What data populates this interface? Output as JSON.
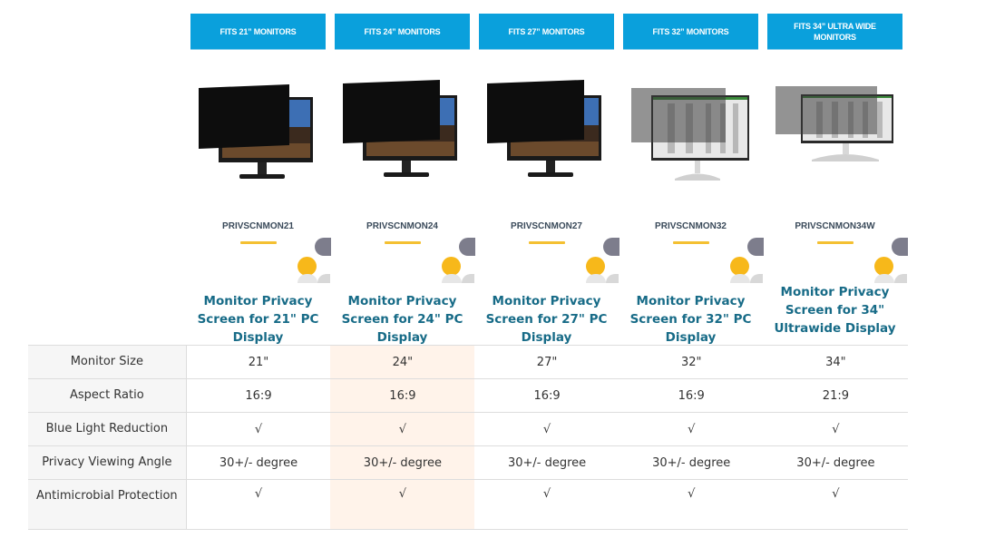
{
  "products": [
    {
      "fit_label": "FITS 21” MONITORS",
      "sku": "PRIVSCNMON21",
      "title": "Monitor Privacy Screen for 21\" PC Display",
      "image": "dark-privacy-monitor-icon",
      "highlighted": false
    },
    {
      "fit_label": "FITS 24” MONITORS",
      "sku": "PRIVSCNMON24",
      "title": "Monitor Privacy Screen for 24\" PC Display",
      "image": "dark-privacy-monitor-icon",
      "highlighted": true
    },
    {
      "fit_label": "FITS 27” MONITORS",
      "sku": "PRIVSCNMON27",
      "title": "Monitor Privacy Screen for 27\" PC Display",
      "image": "dark-privacy-monitor-icon",
      "highlighted": false
    },
    {
      "fit_label": "FITS 32” MONITORS",
      "sku": "PRIVSCNMON32",
      "title": "Monitor Privacy Screen for 32\" PC Display",
      "image": "gray-privacy-monitor-icon",
      "highlighted": false
    },
    {
      "fit_label": "FITS 34” ULTRA WIDE MONITORS",
      "sku": "PRIVSCNMON34W",
      "title": "Monitor Privacy Screen for 34\" Ultrawide Display",
      "image": "ultrawide-privacy-monitor-icon",
      "highlighted": false
    }
  ],
  "rows": [
    {
      "label": "Monitor Size",
      "values": [
        "21\"",
        "24\"",
        "27\"",
        "32\"",
        "34\""
      ]
    },
    {
      "label": "Aspect Ratio",
      "values": [
        "16:9",
        "16:9",
        "16:9",
        "16:9",
        "21:9"
      ]
    },
    {
      "label": "Blue Light Reduction",
      "values": [
        "√",
        "√",
        "√",
        "√",
        "√"
      ]
    },
    {
      "label": "Privacy Viewing Angle",
      "values": [
        "30+/- degree",
        "30+/- degree",
        "30+/- degree",
        "30+/- degree",
        "30+/- degree"
      ]
    },
    {
      "label": "Antimicrobial Protection",
      "values": [
        "√",
        "√",
        "√",
        "√",
        "√"
      ]
    }
  ],
  "colors": {
    "fit_button": "#0aa0dc",
    "title_text": "#176b87",
    "highlight_column": "#fff3ea",
    "accent_yellow": "#f7b81a",
    "label_column_bg": "#f6f6f6"
  }
}
